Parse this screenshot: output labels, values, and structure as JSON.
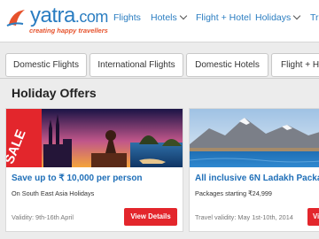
{
  "brand": {
    "name": "yatra",
    "domain": ".com",
    "tagline": "creating happy travellers",
    "colors": {
      "blue": "#2a7dc1",
      "orange": "#e6522c",
      "red": "#e3262c"
    }
  },
  "nav": {
    "items": [
      {
        "label": "Flights",
        "dropdown": false
      },
      {
        "label": "Hotels",
        "dropdown": true
      },
      {
        "label": "Flight + Hotel",
        "dropdown": false
      },
      {
        "label": "Holidays",
        "dropdown": true
      },
      {
        "label": "Tra",
        "dropdown": false
      }
    ]
  },
  "tabs": [
    {
      "label": "Domestic Flights"
    },
    {
      "label": "International Flights"
    },
    {
      "label": "Domestic Hotels"
    },
    {
      "label": "Flight + H"
    }
  ],
  "section": {
    "title": "Holiday Offers"
  },
  "offers": [
    {
      "badge": "SALE",
      "title": "Save up to ₹ 10,000 per person",
      "subtitle": "On South East Asia Holidays",
      "validity": "Validity: 9th-16th April",
      "button": "View Details"
    },
    {
      "title": "All inclusive 6N Ladakh Packag",
      "subtitle": "Packages starting ₹24,999",
      "validity": "Travel validity: May 1st-10th, 2014",
      "button": "Vie"
    }
  ]
}
